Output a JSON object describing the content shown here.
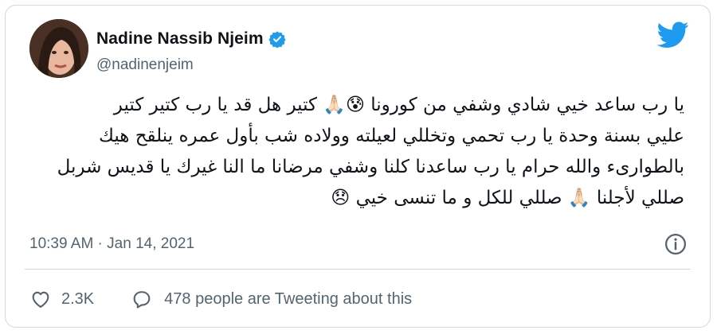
{
  "author": {
    "name": "Nadine Nassib Njeim",
    "handle": "@nadinenjeim",
    "verified": true
  },
  "tweet": {
    "lines": [
      "يا رب ساعد خيي شادي وشفي من كورونا 😰🙏🏻 كتير هل قد يا رب كتير كتير",
      "عليي بسنة وحدة يا رب تحمي وتخللي لعيلته وولاده شب بأول عمره ينلقح هيك",
      "بالطوارىء والله حرام يا رب ساعدنا كلنا وشفي مرضانا ما النا غيرك يا قديس شربل",
      "صللي لأجلنا 🙏🏻 صللي للكل و ما تنسى خيي 😞"
    ],
    "timestamp": "10:39 AM · Jan 14, 2021"
  },
  "engagement": {
    "like_count": "2.3K",
    "tweeting_label": "478 people are Tweeting about this"
  },
  "icons": {
    "brand": "twitter-bird-icon",
    "verified": "verified-badge-icon",
    "info": "info-icon",
    "like": "heart-icon",
    "reply": "speech-bubble-icon"
  },
  "colors": {
    "brand_blue": "#1d9bf0",
    "muted_text": "#536471",
    "border": "#cfd9de"
  }
}
